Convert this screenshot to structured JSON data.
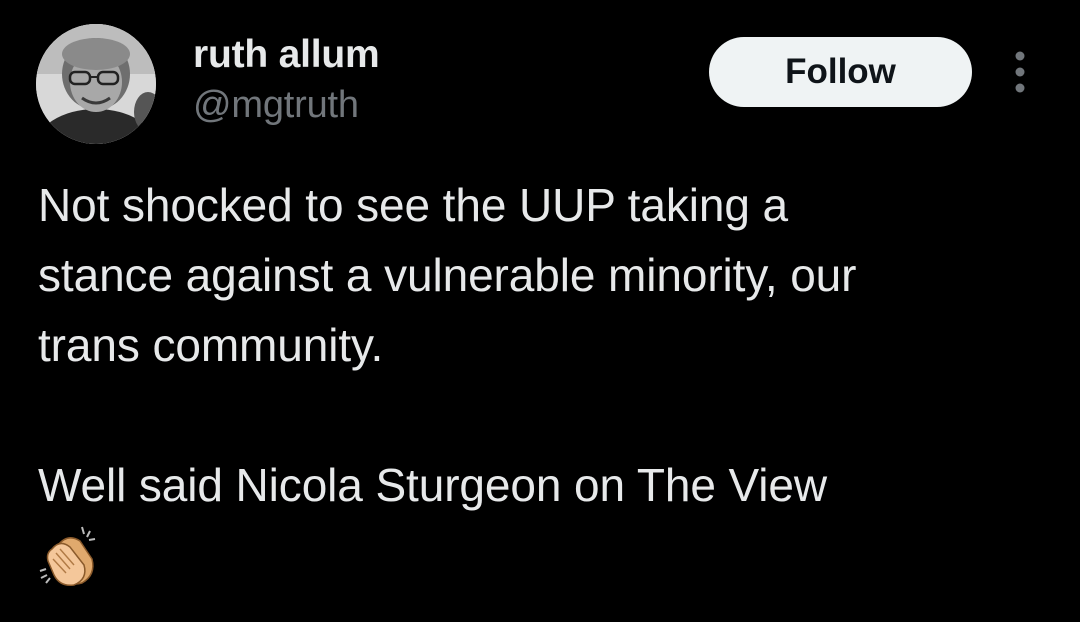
{
  "author": {
    "display_name": "ruth allum",
    "handle": "@mgtruth"
  },
  "actions": {
    "follow_label": "Follow"
  },
  "tweet": {
    "text": "Not shocked to see the UUP taking a\nstance against a vulnerable minority, our\ntrans community.\n\nWell said Nicola Sturgeon on The View",
    "emoji": "clapping-hands"
  },
  "icons": {
    "more": "more-vertical-icon",
    "emoji": "clapping-hands-icon"
  },
  "colors": {
    "background": "#000000",
    "primary_text": "#e7e9ea",
    "secondary_text": "#71767b",
    "follow_button_bg": "#eff3f4",
    "follow_button_text": "#0f1419",
    "emoji_skin": "#f4c79a"
  }
}
